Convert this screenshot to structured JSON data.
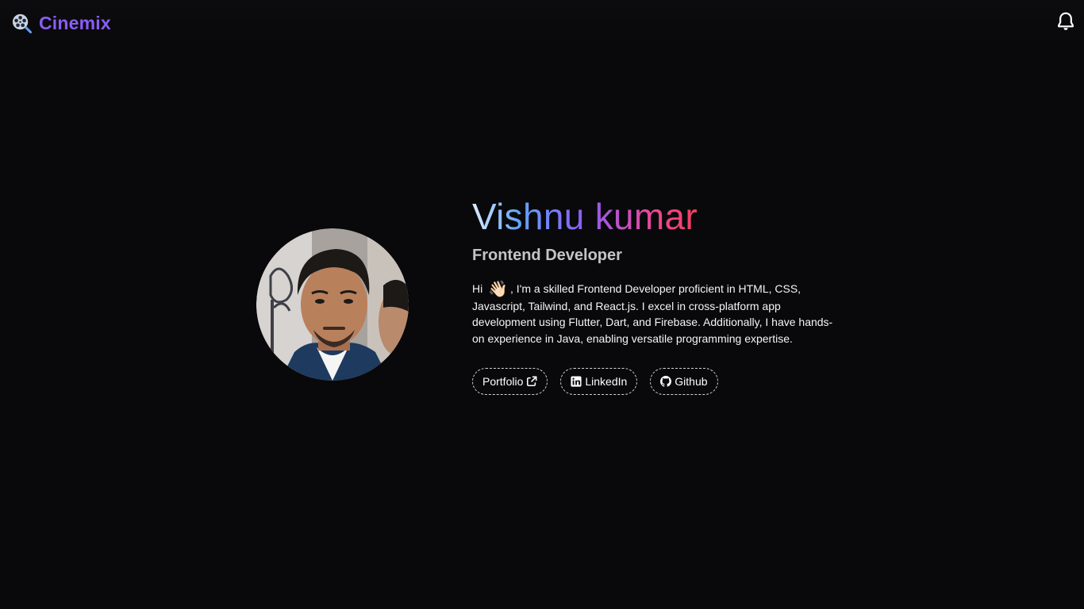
{
  "header": {
    "brand_name": "Cinemix",
    "brand_icon": "film-reel-search-icon",
    "notification_icon": "bell-icon",
    "brand_color": "#8b5cf6"
  },
  "profile": {
    "name": "Vishnu kumar",
    "role": "Frontend Developer",
    "avatar_icon": "profile-photo",
    "bio_greeting": "Hi",
    "bio_emoji": "👋🏻",
    "bio_text": ", I'm a skilled Frontend Developer proficient in HTML, CSS, Javascript, Tailwind, and React.js. I excel in cross-platform app development using Flutter, Dart, and Firebase. Additionally, I have hands-on experience in Java, enabling versatile programming expertise.",
    "name_gradient": [
      "#dbeafe",
      "#60a5fa",
      "#8b5cf6",
      "#ec4899",
      "#f43f5e"
    ]
  },
  "links": [
    {
      "label": "Portfolio",
      "icon": "external-link-icon"
    },
    {
      "label": "LinkedIn",
      "icon": "linkedin-icon"
    },
    {
      "label": "Github",
      "icon": "github-icon"
    }
  ]
}
